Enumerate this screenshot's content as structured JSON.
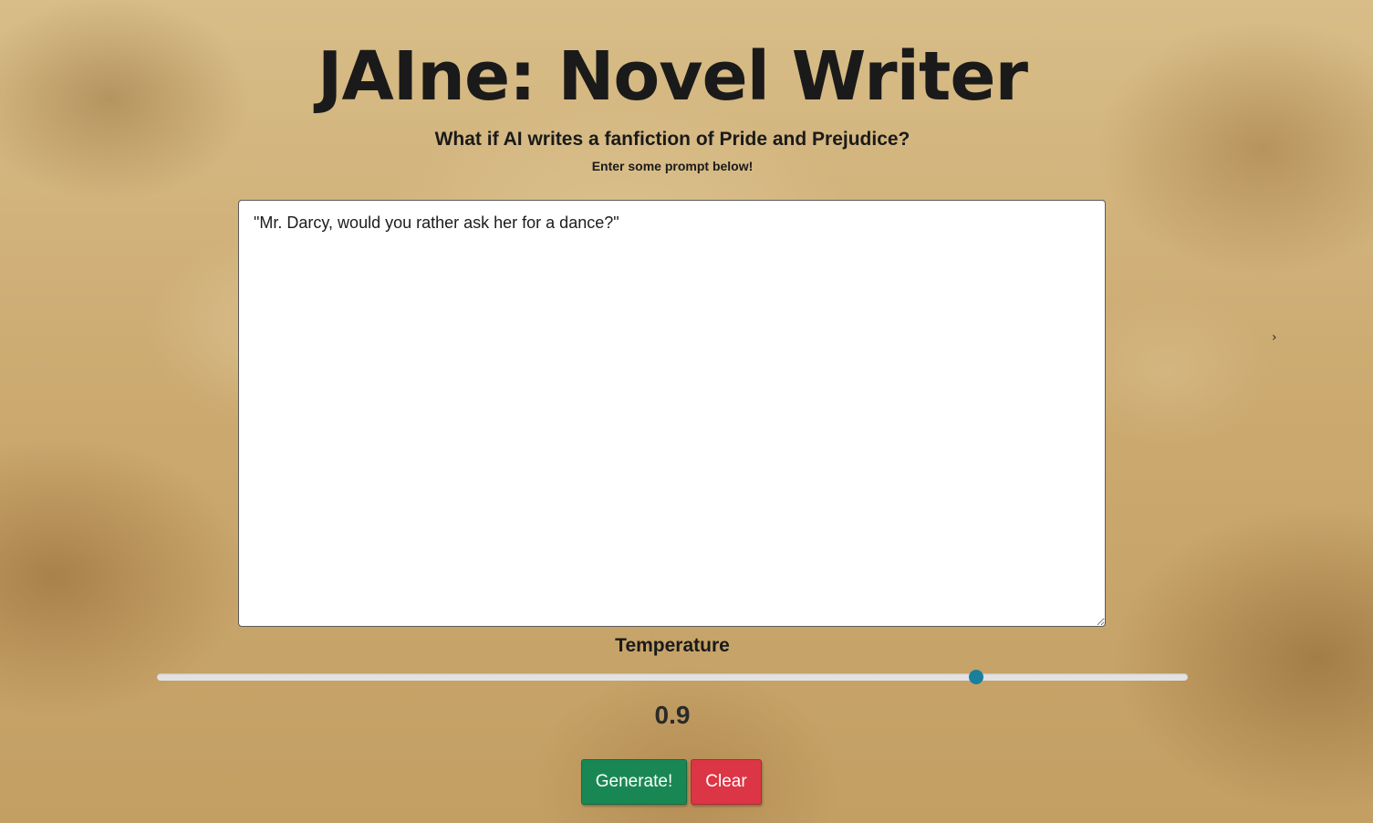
{
  "header": {
    "title": "JAIne: Novel Writer",
    "subtitle": "What if AI writes a fanfiction of Pride and Prejudice?",
    "hint": "Enter some prompt below!"
  },
  "prompt": {
    "value": "\"Mr. Darcy, would you rather ask her for a dance?\""
  },
  "temperature": {
    "label": "Temperature",
    "value": "0.9",
    "slider_fraction": 0.795,
    "thumb_color": "#1a7f9c"
  },
  "actions": {
    "generate_label": "Generate!",
    "generate_color": "#198754",
    "clear_label": "Clear",
    "clear_color": "#dc3545"
  },
  "icons": {
    "edge_arrow": "chevron-right-icon"
  }
}
